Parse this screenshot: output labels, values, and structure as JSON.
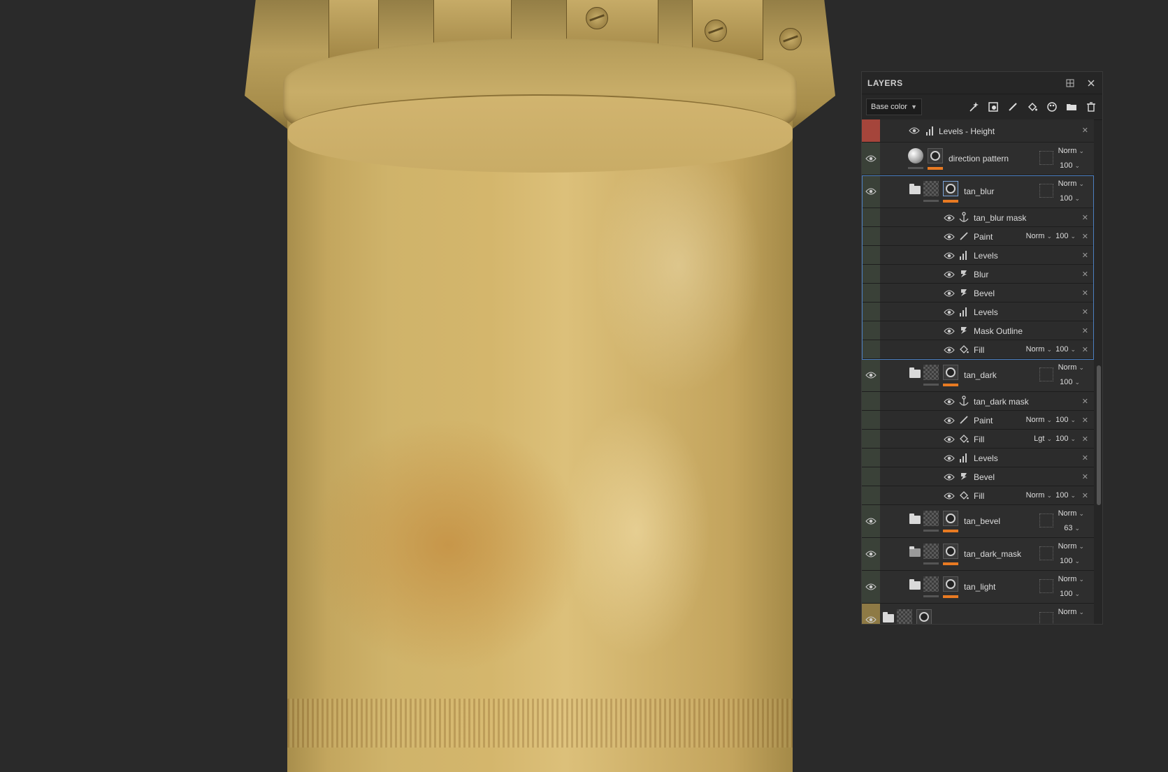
{
  "panel": {
    "title": "LAYERS",
    "channel_label": "Base color",
    "tools": [
      "magic-wand-icon",
      "fill-mask-icon",
      "brush-icon",
      "paint-bucket-icon",
      "palette-icon",
      "folder-icon",
      "trash-icon"
    ]
  },
  "layers": {
    "levels_height": {
      "name": "Levels - Height"
    },
    "direction_pattern": {
      "name": "direction pattern",
      "blend": "Norm",
      "opacity": "100"
    },
    "tan_blur": {
      "name": "tan_blur",
      "blend": "Norm",
      "opacity": "100",
      "effects": [
        {
          "name": "tan_blur mask",
          "icon": "anchor-icon"
        },
        {
          "name": "Paint",
          "icon": "brush-icon",
          "blend": "Norm",
          "opacity": "100"
        },
        {
          "name": "Levels",
          "icon": "levels-icon"
        },
        {
          "name": "Blur",
          "icon": "filter-icon"
        },
        {
          "name": "Bevel",
          "icon": "filter-icon"
        },
        {
          "name": "Levels",
          "icon": "levels-icon"
        },
        {
          "name": "Mask Outline",
          "icon": "filter-icon"
        },
        {
          "name": "Fill",
          "icon": "fill-icon",
          "blend": "Norm",
          "opacity": "100"
        }
      ]
    },
    "tan_dark": {
      "name": "tan_dark",
      "blend": "Norm",
      "opacity": "100",
      "effects": [
        {
          "name": "tan_dark mask",
          "icon": "anchor-icon"
        },
        {
          "name": "Paint",
          "icon": "brush-icon",
          "blend": "Norm",
          "opacity": "100"
        },
        {
          "name": "Fill",
          "icon": "fill-icon",
          "blend": "Lgt",
          "opacity": "100"
        },
        {
          "name": "Levels",
          "icon": "levels-icon"
        },
        {
          "name": "Bevel",
          "icon": "filter-icon"
        },
        {
          "name": "Fill",
          "icon": "fill-icon",
          "blend": "Norm",
          "opacity": "100"
        }
      ]
    },
    "tan_bevel": {
      "name": "tan_bevel",
      "blend": "Norm",
      "opacity": "63"
    },
    "tan_dark_mask": {
      "name": "tan_dark_mask",
      "blend": "Norm",
      "opacity": "100"
    },
    "tan_light": {
      "name": "tan_light",
      "blend": "Norm",
      "opacity": "100"
    },
    "partial": {
      "blend": "Norm"
    }
  },
  "colors": {
    "accent_orange": "#e87a22",
    "selection_blue": "#4c7fc0",
    "layer_red": "#a5453b"
  }
}
